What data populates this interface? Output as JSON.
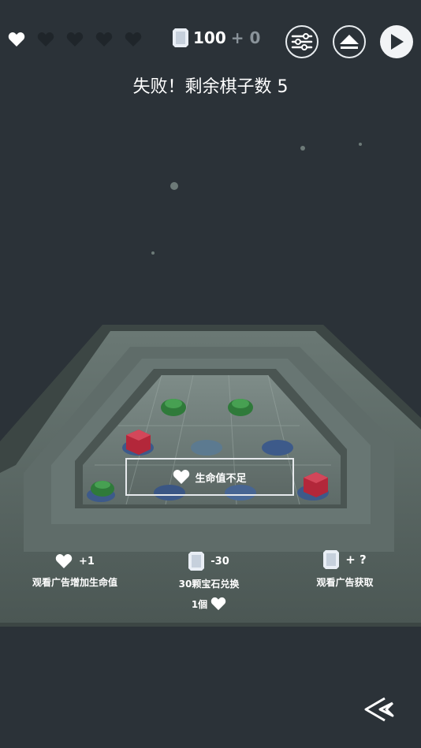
{
  "hud": {
    "lives_total": 5,
    "lives_filled": 1,
    "gems": "100",
    "gem_bonus": "+ 0"
  },
  "title": "失败！剩余棋子数 5",
  "notice": {
    "text": "生命值不足"
  },
  "options": [
    {
      "amount": "+1",
      "label": "观看广告增加生命值"
    },
    {
      "amount": "-30",
      "label": "30颗宝石兑换",
      "sub": "1個"
    },
    {
      "amount": "+ ?",
      "label": "观看广告获取"
    }
  ],
  "colors": {
    "background": "#2b3238",
    "board": "#5a6763",
    "piece_green": "#2f7a3a",
    "piece_red": "#b3273a",
    "hole_blue": "#3d5a8a",
    "text": "#ffffff"
  },
  "icons": [
    "heart-icon",
    "gem-icon",
    "settings-icon",
    "levels-icon",
    "play-icon",
    "back-icon"
  ]
}
